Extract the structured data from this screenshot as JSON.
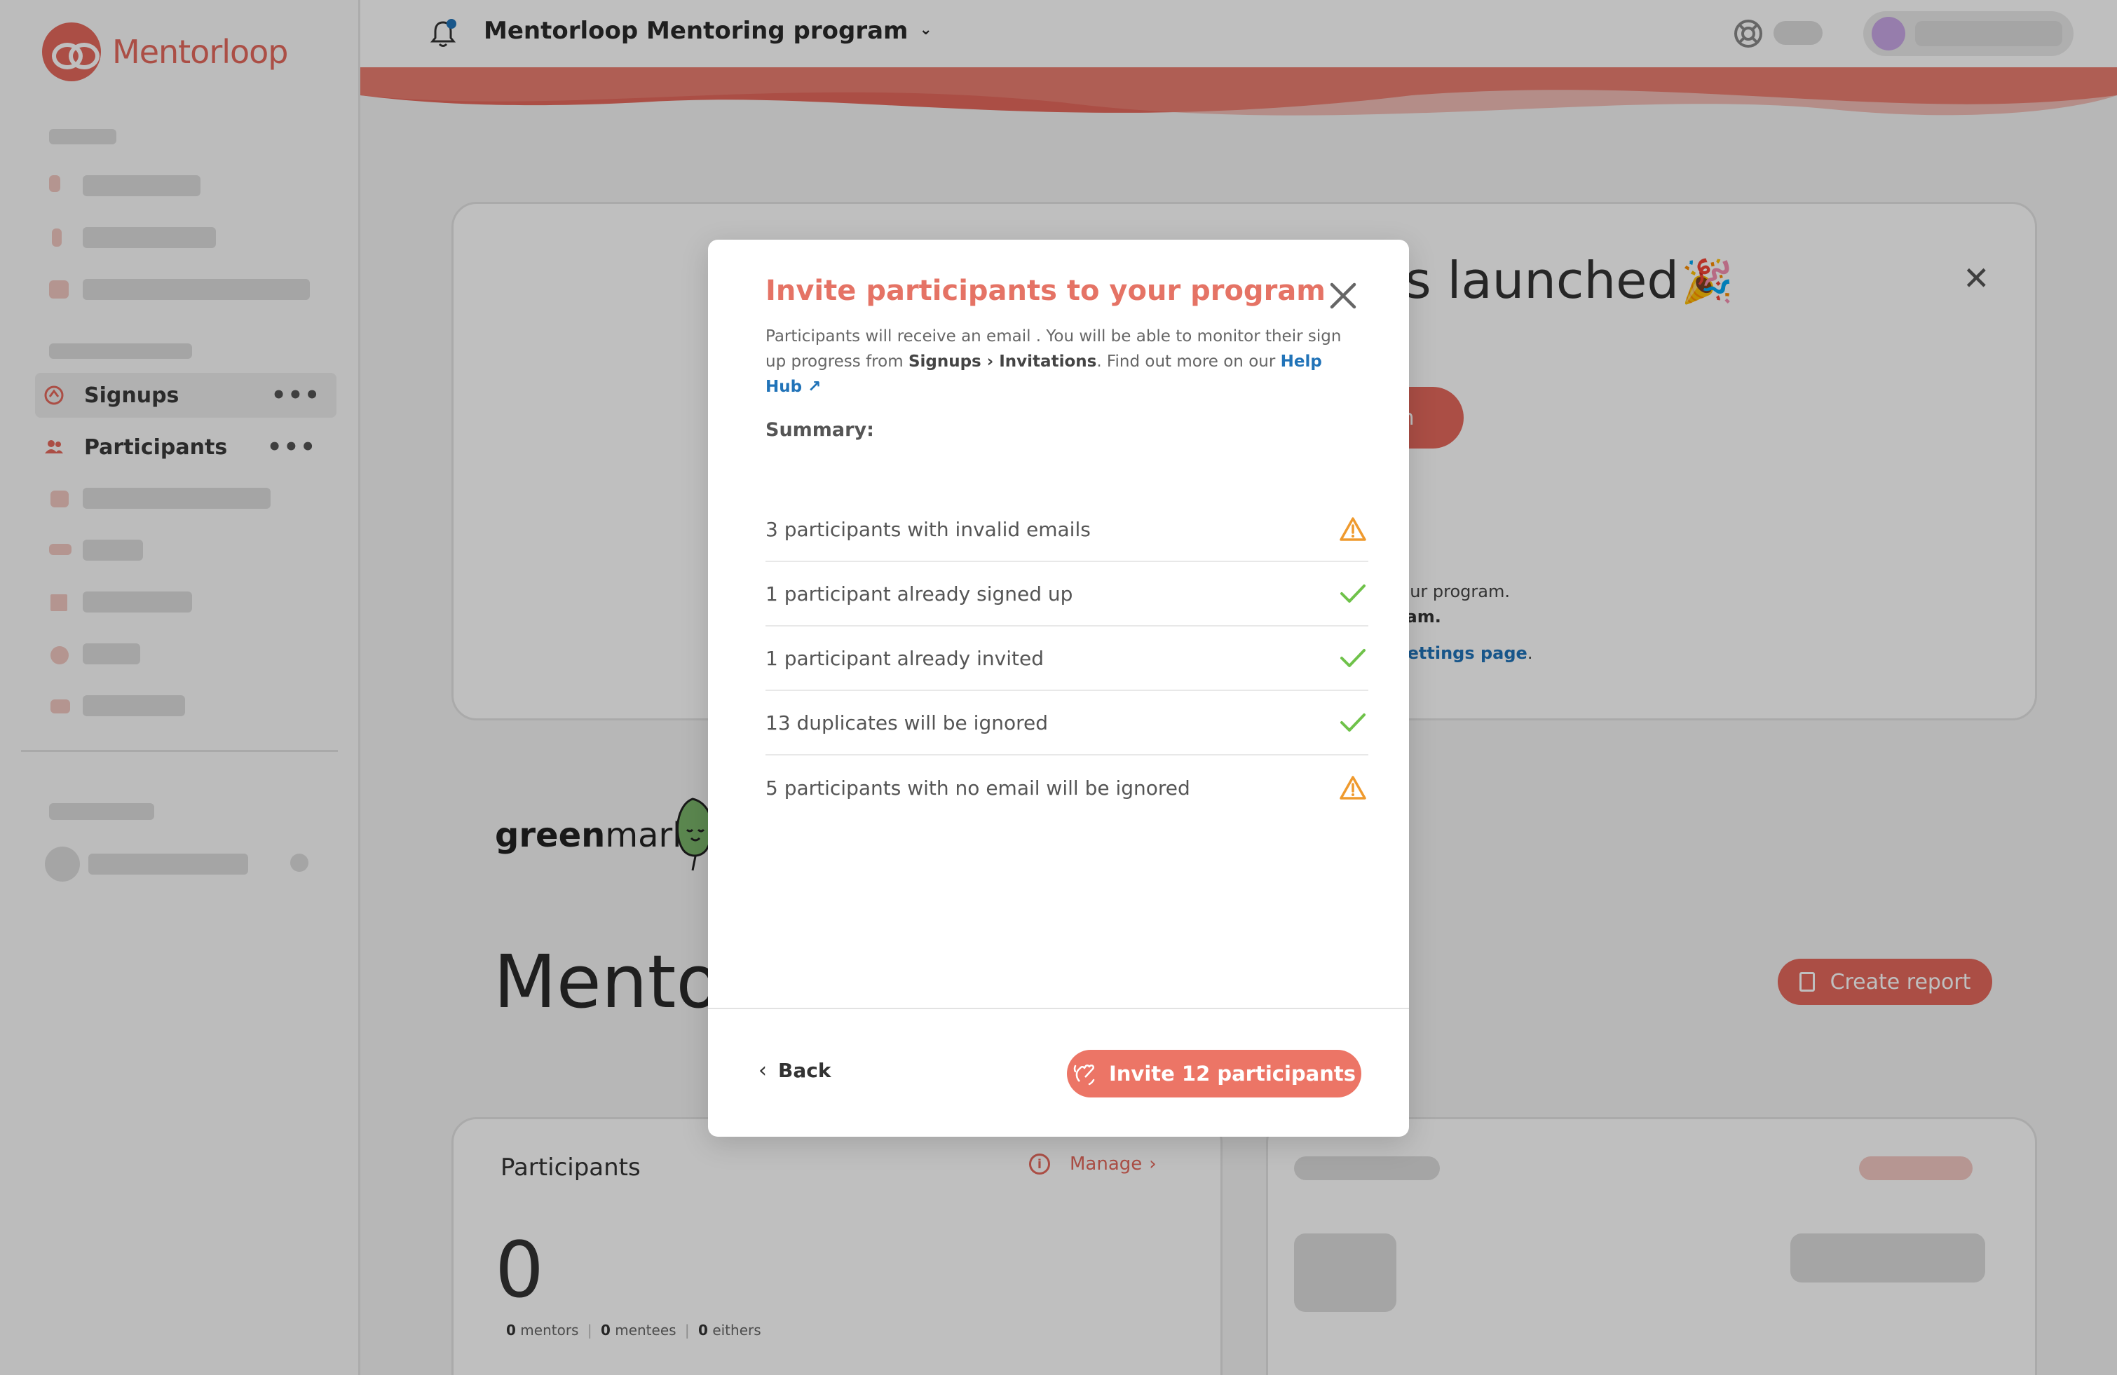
{
  "sidebar": {
    "logo_text": "Mentorloop",
    "items": [
      {
        "label": "Signups",
        "more": "•••"
      },
      {
        "label": "Participants",
        "more": "•••"
      }
    ]
  },
  "topbar": {
    "program_title": "Mentorloop Mentoring program"
  },
  "background": {
    "launch_title": "as launched",
    "launch_button_fragment": "am",
    "launch_text_1": "o your program.",
    "launch_text_2": "ogram.",
    "launch_link": "m settings page",
    "launch_link_suffix": ".",
    "org_logo_text_bold": "green",
    "org_logo_text": "mark",
    "page_heading": "Mentor",
    "create_report_label": "Create report",
    "participants_card": {
      "title": "Participants",
      "manage_label": "Manage",
      "total": "0",
      "mentors_count": "0",
      "mentors_label": "mentors",
      "mentees_count": "0",
      "mentees_label": "mentees",
      "eithers_count": "0",
      "eithers_label": "eithers",
      "separator": "|"
    }
  },
  "modal": {
    "title": "Invite participants to your program",
    "desc_part1": "Participants will receive an email . You will be able to monitor their sign up progress from ",
    "desc_path": "Signups › Invitations",
    "desc_part2": ". Find out more on our ",
    "help_link": "Help Hub ↗",
    "summary_label": "Summary:",
    "rows": [
      {
        "text": "3 participants with invalid emails",
        "status": "warning"
      },
      {
        "text": "1 participant already signed up",
        "status": "ok"
      },
      {
        "text": "1 participant already invited",
        "status": "ok"
      },
      {
        "text": "13 duplicates will be ignored",
        "status": "ok"
      },
      {
        "text": "5 participants with no email will be ignored",
        "status": "warning"
      }
    ],
    "back_label": "Back",
    "invite_label": "Invite 12 participants"
  },
  "colors": {
    "brand": "#e4685c",
    "warning": "#ef9a2e",
    "success": "#6fc24a",
    "link": "#2173b8"
  }
}
